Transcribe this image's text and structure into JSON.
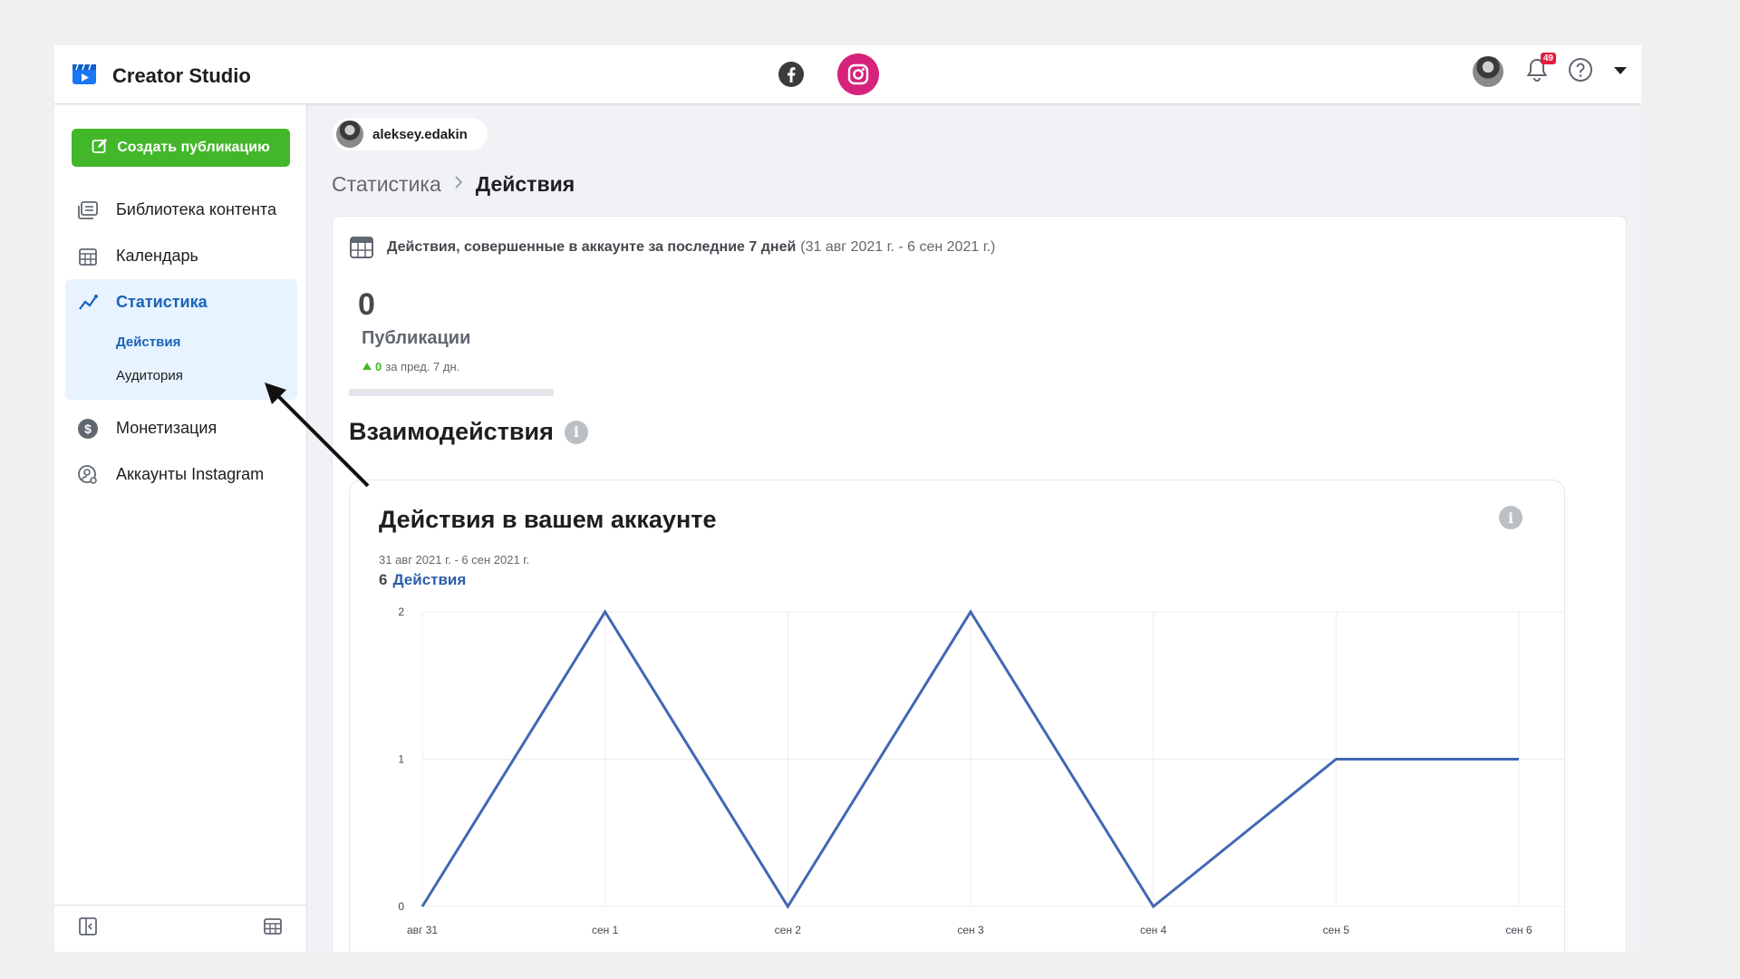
{
  "topbar": {
    "title": "Creator Studio",
    "platforms": [
      "facebook-icon",
      "instagram-icon"
    ],
    "notification_count": "49"
  },
  "sidebar": {
    "create_label": "Создать публикацию",
    "items": [
      {
        "label": "Библиотека контента",
        "icon": "content-library-icon"
      },
      {
        "label": "Календарь",
        "icon": "calendar-icon"
      },
      {
        "label": "Статистика",
        "icon": "insights-icon"
      },
      {
        "label": "Монетизация",
        "icon": "dollar-icon"
      },
      {
        "label": "Аккаунты Instagram",
        "icon": "instagram-accounts-icon"
      }
    ],
    "subitems": [
      {
        "label": "Действия"
      },
      {
        "label": "Аудитория"
      }
    ]
  },
  "account": {
    "name": "aleksey.edakin"
  },
  "breadcrumb": {
    "parent": "Статистика",
    "current": "Действия"
  },
  "summary": {
    "heading_bold": "Действия, совершенные в аккаунте за последние 7 дней",
    "heading_range": "(31 авг 2021 г. - 6 сен 2021 г.)",
    "metric_value": "0",
    "metric_label": "Публикации",
    "delta_value": "0",
    "delta_text": "за пред. 7 дн."
  },
  "section_title": "Взаимодействия",
  "panel": {
    "title": "Действия в вашем аккаунте",
    "range": "31 авг 2021 г. - 6 сен 2021 г.",
    "total": "6",
    "total_label": "Действия"
  },
  "colors": {
    "accent": "#42b72a",
    "link": "#1b63b8",
    "line": "#4267b2",
    "instagram": "#d6227a"
  },
  "chart_data": {
    "type": "line",
    "categories": [
      "авг 31",
      "сен 1",
      "сен 2",
      "сен 3",
      "сен 4",
      "сен 5",
      "сен 6"
    ],
    "series": [
      {
        "values": [
          0,
          2,
          0,
          2,
          0,
          1,
          1
        ]
      }
    ],
    "ylim": [
      0,
      2
    ],
    "yticks": [
      "0",
      "1",
      "2"
    ],
    "grid": true
  }
}
